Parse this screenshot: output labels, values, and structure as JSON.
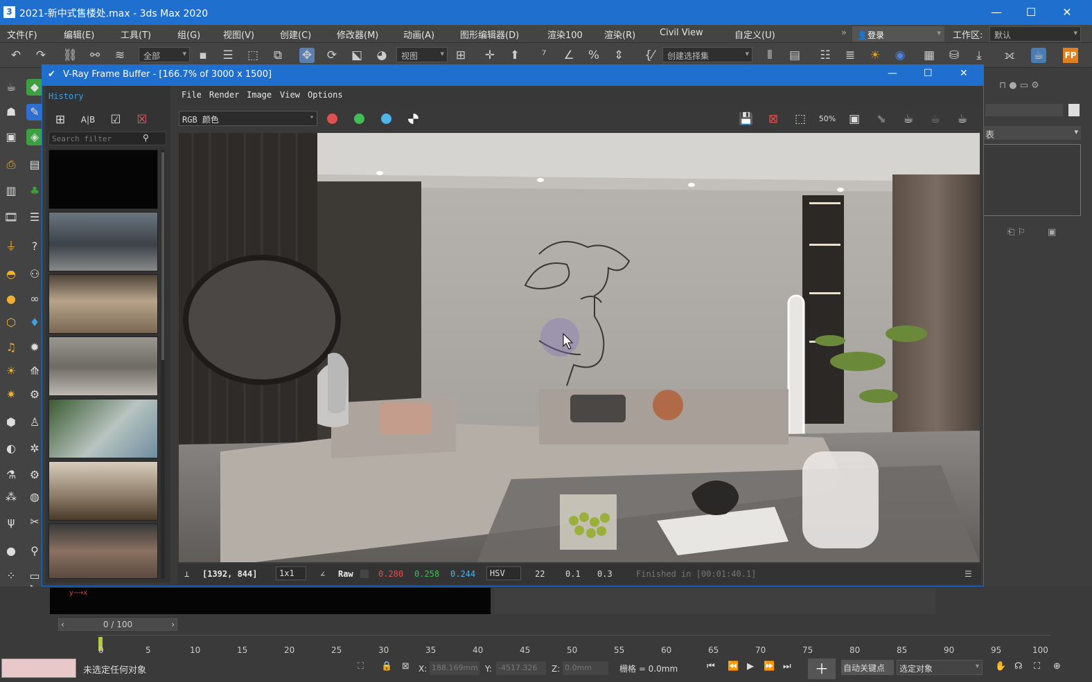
{
  "app": {
    "title": "2021-新中式售楼处.max - 3ds Max 2020",
    "logo": "3"
  },
  "window_controls": {
    "minimize": "—",
    "maximize": "☐",
    "close": "✕"
  },
  "menu": [
    "文件(F)",
    "编辑(E)",
    "工具(T)",
    "组(G)",
    "视图(V)",
    "创建(C)",
    "修改器(M)",
    "动画(A)",
    "图形编辑器(D)",
    "渲染100",
    "渲染(R)",
    "Civil View",
    "自定义(U)"
  ],
  "toolbar": {
    "selection_filter": "全部",
    "ref_coord": "视图",
    "named_selection": "创建选择集",
    "login": "登录",
    "workspace_label": "工作区:",
    "workspace_value": "默认"
  },
  "vfb": {
    "title": "V-Ray Frame Buffer - [166.7% of 3000 x 1500]",
    "history_label": "History",
    "search_placeholder": "Search filter",
    "menu": [
      "File",
      "Render",
      "Image",
      "View",
      "Options"
    ],
    "channel": "RGB 颜色",
    "zoom_badge": "50%",
    "status": {
      "coords": "[1392, 844]",
      "zoom": "1x1",
      "mode": "Raw",
      "r": "0.280",
      "g": "0.258",
      "b": "0.244",
      "colorspace": "HSV",
      "h": "22",
      "s": "0.1",
      "v": "0.3",
      "finished": "Finished in [00:01:40.1]"
    }
  },
  "right_panel": {
    "label": "表"
  },
  "timeline": {
    "frame": "0 / 100",
    "ticks": [
      "0",
      "5",
      "10",
      "15",
      "20",
      "25",
      "30",
      "35",
      "40",
      "45",
      "50",
      "55",
      "60",
      "65",
      "70",
      "75",
      "80",
      "85",
      "90",
      "95",
      "100"
    ]
  },
  "statusbar": {
    "selection": "未选定任何对象",
    "x_label": "X:",
    "x": "188.169mm",
    "y_label": "Y:",
    "y": "-4517.326",
    "z_label": "Z:",
    "z": "0.0mm",
    "grid": "栅格 = 0.0mm",
    "autokey": "自动关键点",
    "set_key_filter": "选定对象"
  },
  "colors": {
    "accent": "#1e6fce",
    "red_dot": "#e05050",
    "green_dot": "#3fbf55",
    "blue_dot": "#50b4e8"
  }
}
